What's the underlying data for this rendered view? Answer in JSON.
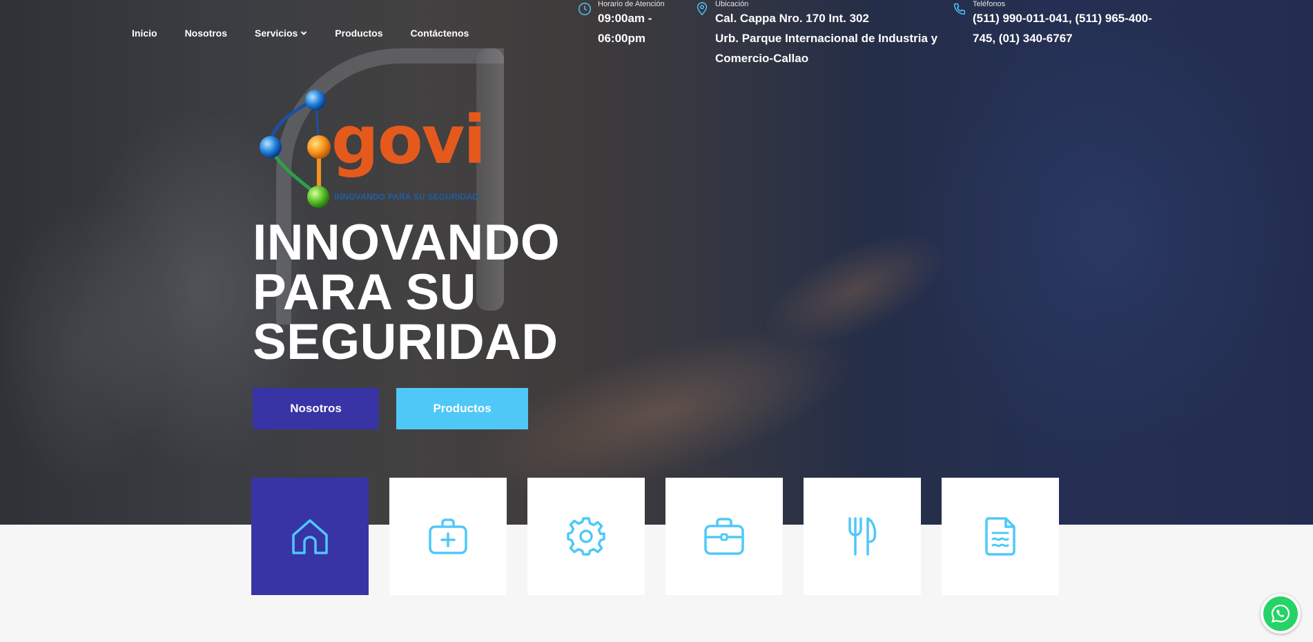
{
  "nav": {
    "items": [
      {
        "label": "Inicio"
      },
      {
        "label": "Nosotros"
      },
      {
        "label": "Servicios"
      },
      {
        "label": "Productos"
      },
      {
        "label": "Contáctenos"
      }
    ]
  },
  "info": {
    "hours": {
      "title": "Horario de Atención",
      "line1": "09:00am -",
      "line2": "06:00pm",
      "icon": "clock-icon"
    },
    "location": {
      "title": "Ubicación",
      "line1": "Cal. Cappa Nro. 170 Int. 302",
      "line2": "Urb. Parque Internacional de Industria y",
      "line3": "Comercio-Callao",
      "icon": "map-pin-icon"
    },
    "phones": {
      "title": "Teléfonos",
      "line1": "(511) 990-011-041, (511) 965-400-",
      "line2": "745, (01) 340-6767",
      "icon": "phone-icon"
    }
  },
  "logo": {
    "brand": "govi",
    "tagline": "INNOVANDO PARA SU SEGURIDAD"
  },
  "hero": {
    "headline_1": "INNOVANDO",
    "headline_2": "PARA SU",
    "headline_3": "SEGURIDAD",
    "btn_primary": "Nosotros",
    "btn_secondary": "Productos"
  },
  "tiles": [
    {
      "icon": "home-icon",
      "active": true
    },
    {
      "icon": "medical-kit-icon",
      "active": false
    },
    {
      "icon": "gear-icon",
      "active": false
    },
    {
      "icon": "briefcase-icon",
      "active": false
    },
    {
      "icon": "fork-knife-icon",
      "active": false
    },
    {
      "icon": "document-icon",
      "active": false
    }
  ],
  "colors": {
    "primary": "#3834a6",
    "accent": "#4fc8f8",
    "logo_orange": "#e55a1c",
    "whatsapp": "#25d366"
  }
}
